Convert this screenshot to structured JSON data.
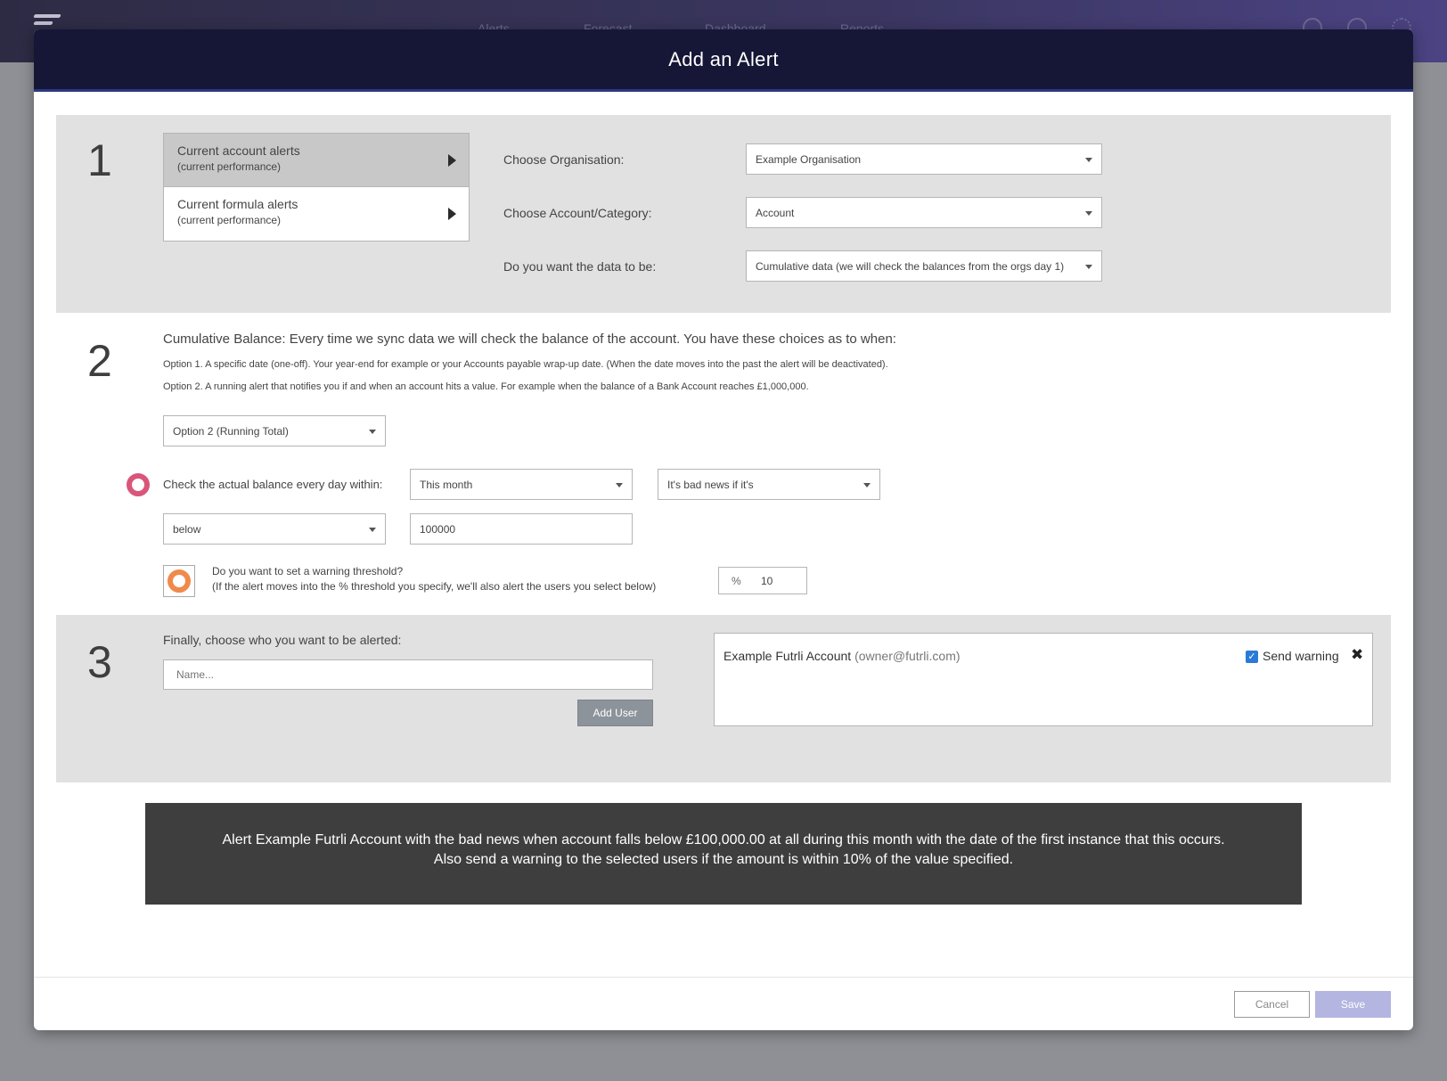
{
  "app_nav": {
    "links": [
      "Alerts",
      "Forecast",
      "Dashboard",
      "Reports"
    ],
    "icons": [
      "search-icon",
      "help-icon",
      "settings-icon"
    ]
  },
  "modal": {
    "title": "Add an Alert"
  },
  "section1": {
    "number": "1",
    "tabs": [
      {
        "title": "Current account alerts",
        "subtitle": "(current performance)",
        "active": true
      },
      {
        "title": "Current formula alerts",
        "subtitle": "(current performance)",
        "active": false
      }
    ],
    "org_label": "Choose Organisation:",
    "org_value": "Example Organisation",
    "account_label": "Choose Account/Category:",
    "account_value": "Account",
    "data_label": "Do you want the data to be:",
    "data_value": "Cumulative data (we will check the balances from the orgs day 1)"
  },
  "section2": {
    "number": "2",
    "intro": "Cumulative Balance: Every time we sync data we will check the balance of the account. You have these choices as to when:",
    "option1": "Option 1. A specific date (one-off). Your year-end for example or your Accounts payable wrap-up date. (When the date moves into the past the alert will be deactivated).",
    "option2": "Option 2. A running alert that notifies you if and when an account hits a value. For example when the balance of a Bank Account reaches £1,000,000.",
    "option_select": "Option 2 (Running Total)",
    "check_label": "Check the actual balance every day within:",
    "period_select": "This month",
    "news_select": "It's bad news if it's",
    "comparison_select": "below",
    "amount_value": "100000",
    "warning_question": "Do you want to set a warning threshold?",
    "warning_note": "(If the alert moves into the % threshold you specify, we'll also alert the users you select below)",
    "pct_symbol": "%",
    "pct_value": "10"
  },
  "section3": {
    "number": "3",
    "prompt": "Finally, choose who you want to be alerted:",
    "name_placeholder": "Name...",
    "add_user_label": "Add User",
    "user_name": "Example Futrli Account",
    "user_email": "(owner@futrli.com)",
    "send_warning_label": "Send warning",
    "send_warning_checked": true
  },
  "summary": {
    "line1": "Alert Example Futrli Account with the bad news when account falls below £100,000.00 at all during this month  with the date of the first instance that this occurs.",
    "line2": "Also send a warning to the selected users if the amount is within 10% of the value specified."
  },
  "footer": {
    "cancel_label": "Cancel",
    "save_label": "Save"
  },
  "colors": {
    "header_bg": "#161636",
    "radio_pink": "#d9567a",
    "radio_orange": "#f08a4b",
    "save_btn": "#b4b5e0",
    "summary_bg": "#3e3e3e"
  }
}
